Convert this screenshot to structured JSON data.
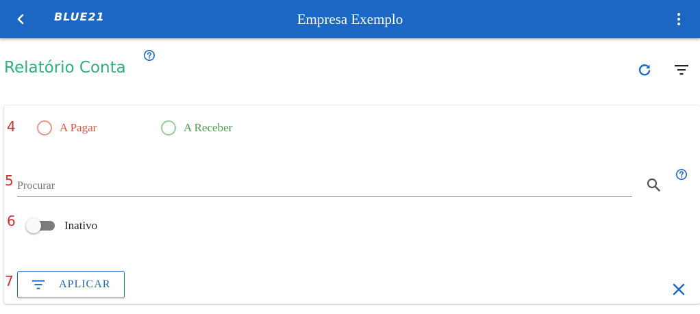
{
  "header": {
    "logo": "BLUE21",
    "title": "Empresa Exemplo",
    "back_icon": "chevron-left-icon",
    "menu_icon": "more-vertical-icon",
    "color": "#1c67c3"
  },
  "page": {
    "title": "Relatório Conta",
    "title_color": "#2eaf7d",
    "actions": [
      "refresh-icon",
      "filter-icon"
    ]
  },
  "markers": [
    "4",
    "5",
    "6",
    "7"
  ],
  "filters": {
    "radio_options": [
      {
        "label": "A Pagar",
        "color": "#e05340",
        "selected": false
      },
      {
        "label": "A Receber",
        "color": "#43a047",
        "selected": false
      }
    ],
    "search": {
      "placeholder": "Procurar",
      "value": ""
    },
    "inactive_toggle": {
      "label": "Inativo",
      "checked": false
    },
    "apply_button": {
      "label": "APLICAR"
    },
    "close_icon": "close-icon"
  }
}
